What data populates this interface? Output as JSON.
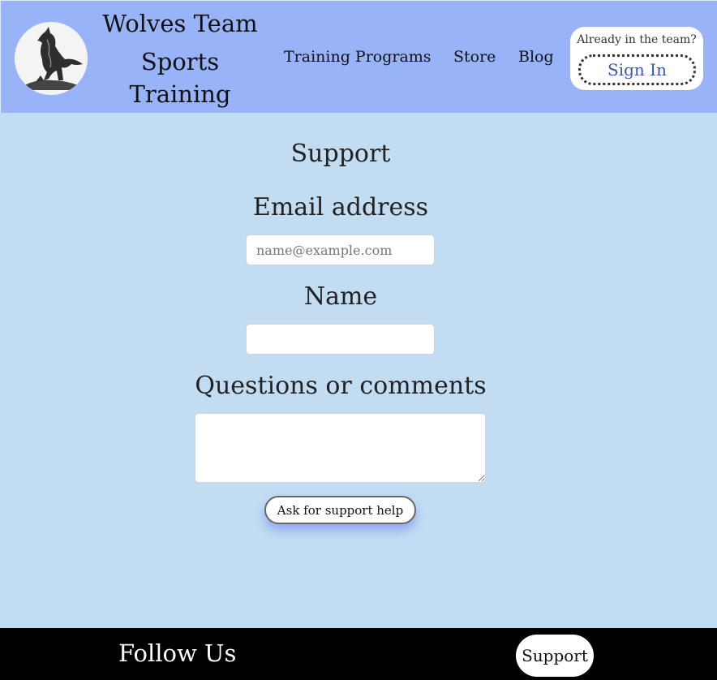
{
  "header": {
    "brand_line1": "Wolves Team",
    "brand_line2": "Sports",
    "brand_line3": "Training",
    "logo_icon": "wolf-logo-icon",
    "nav": {
      "programs": "Training Programs",
      "store": "Store",
      "blog": "Blog"
    },
    "signin": {
      "caption": "Already in the team?",
      "button": "Sign In"
    }
  },
  "main": {
    "title": "Support",
    "email_label": "Email address",
    "email_placeholder": "name@example.com",
    "email_value": "",
    "name_label": "Name",
    "name_value": "",
    "comments_label": "Questions or comments",
    "comments_value": "",
    "submit_label": "Ask for support help"
  },
  "footer": {
    "follow": "Follow Us",
    "support": "Support"
  },
  "colors": {
    "header_bg": "#98b3f7",
    "page_bg": "#c2dcf2",
    "footer_bg": "#000000",
    "signin_text": "#3b57b3"
  }
}
